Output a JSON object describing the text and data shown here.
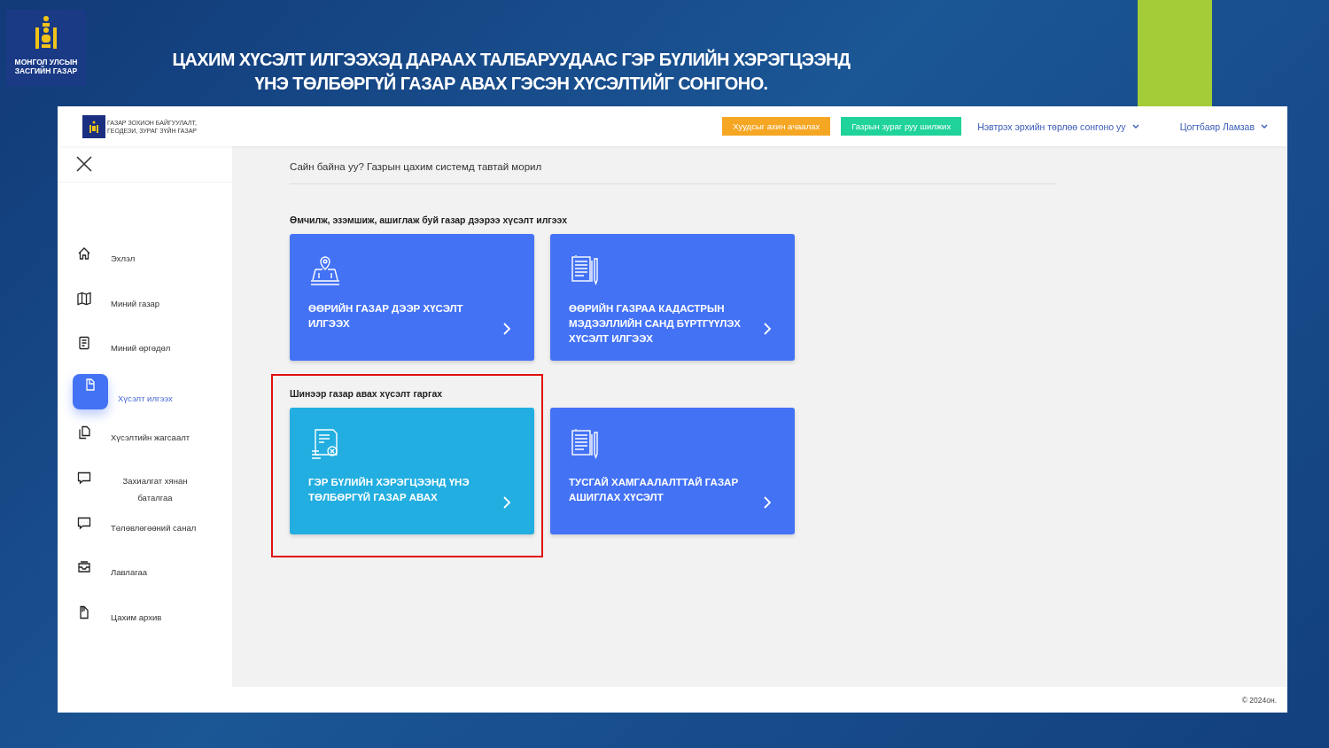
{
  "slide": {
    "logo_lines": [
      "МОНГОЛ УЛСЫН",
      "ЗАСГИЙН ГАЗАР"
    ],
    "title_lines": [
      "ЦАХИМ ХҮСЭЛТ ИЛГЭЭХЭД ДАРААХ ТАЛБАРУУДААС ГЭР БҮЛИЙН ХЭРЭГЦЭЭНД",
      "ҮНЭ ТӨЛБӨРГҮЙ ГАЗАР АВАХ ГЭСЭН ХҮСЭЛТИЙГ СОНГОНО."
    ]
  },
  "app": {
    "brand_lines": [
      "ГАЗАР ЗОХИОН БАЙГУУЛАЛТ,",
      "ГЕОДЕЗИ, ЗУРАГ ЗҮЙН ГАЗАР"
    ],
    "header_buttons": [
      {
        "label": "Хуудсыг ахин ачаалах",
        "color": "#f5a623"
      },
      {
        "label": "Газрын зураг руу шилжих",
        "color": "#1fd39a"
      }
    ],
    "menus": [
      {
        "label": "Нэвтрэх эрхийн төрлөө сонгоно уу"
      },
      {
        "label": "Цогтбаяр Ламзав"
      }
    ],
    "sidebar": {
      "items": [
        {
          "label": "Эхлэл",
          "kind": "home",
          "selected": false
        },
        {
          "label": "Миний газар",
          "kind": "map",
          "selected": false
        },
        {
          "label": "Миний өргөдөл",
          "kind": "document",
          "selected": false
        },
        {
          "label": "Хүсэлт илгээх",
          "kind": "file",
          "selected": true
        },
        {
          "label": "Хүсэлтийн жагсаалт",
          "kind": "files",
          "selected": false
        },
        {
          "label": "Захиалгат хянан баталгаа",
          "kind": "chat",
          "selected": false
        },
        {
          "label": "Төлөвлөгөөний санал",
          "kind": "chat",
          "selected": false
        },
        {
          "label": "Лавлагаа",
          "kind": "inbox",
          "selected": false
        },
        {
          "label": "Цахим архив",
          "kind": "archive",
          "selected": false
        }
      ]
    },
    "greeting": "Сайн байна уу? Газрын цахим системд тавтай морил",
    "groups": [
      {
        "heading": "Өмчилж, эзэмшиж, ашиглаж буй газар дээрээ хүсэлт илгээх",
        "highlighted": false,
        "cards": [
          {
            "title": "ӨӨРИЙН ГАЗАР ДЭЭР ХҮСЭЛТ ИЛГЭЭХ",
            "kind": "survey",
            "color": "#4372f5"
          },
          {
            "title": "ӨӨРИЙН ГАЗРАА КАДАСТРЫН МЭДЭЭЛЛИЙН САНД БҮРТГҮҮЛЭХ ХҮСЭЛТ ИЛГЭЭХ",
            "kind": "documents",
            "color": "#4372f5"
          }
        ]
      },
      {
        "heading": "Шинээр газар авах хүсэлт гаргах",
        "highlighted": true,
        "cards": [
          {
            "title": "ГЭР БҮЛИЙН ХЭРЭГЦЭЭНД ҮНЭ ТӨЛБӨРГҮЙ ГАЗАР АВАХ",
            "kind": "certificate",
            "color": "#22aee0"
          },
          {
            "title": "ТУСГАЙ ХАМГААЛАЛТТАЙ ГАЗАР АШИГЛАХ ХҮСЭЛТ",
            "kind": "documents",
            "color": "#4372f5"
          }
        ]
      }
    ],
    "footer": "© 2024он."
  }
}
